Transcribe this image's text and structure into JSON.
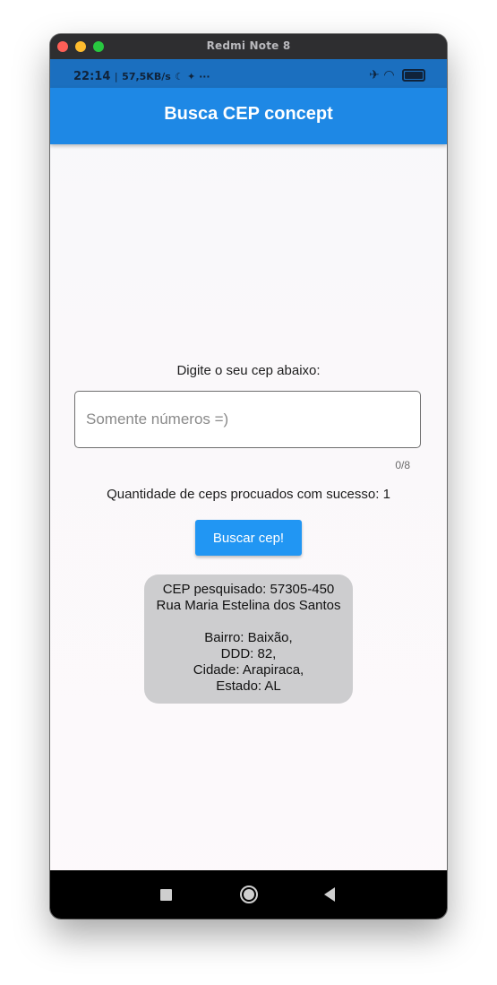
{
  "window": {
    "title": "Redmi Note 8"
  },
  "statusbar": {
    "time": "22:14",
    "separator": "|",
    "speed": "57,5KB/s",
    "extra": "☾ ✦ ···",
    "icons": "✈ ◠"
  },
  "appbar": {
    "title": "Busca CEP concept"
  },
  "form": {
    "prompt": "Digite o seu cep abaixo:",
    "placeholder": "Somente números =)",
    "value": "",
    "counter": "0/8",
    "success_count": "Quantidade de ceps procuados com sucesso: 1",
    "search_label": "Buscar cep!"
  },
  "result": {
    "cep": "CEP pesquisado: 57305-450",
    "street": "Rua Maria Estelina dos Santos",
    "bairro": "Bairro: Baixão,",
    "ddd": "DDD: 82,",
    "cidade": "Cidade: Arapiraca,",
    "estado": "Estado: AL"
  },
  "colors": {
    "statusbar": "#1b6fbf",
    "appbar": "#1e88e5",
    "button": "#2196f3",
    "card": "#cdcdcf"
  }
}
